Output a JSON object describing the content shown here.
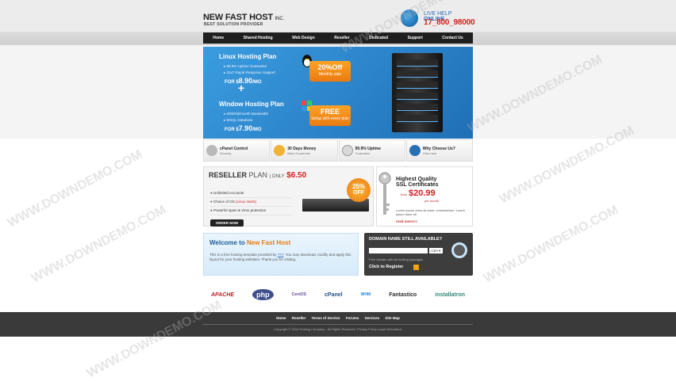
{
  "header": {
    "logo_main": "NEW FAST HOST",
    "logo_suffix": "INC.",
    "tagline": "BEST SOLUTION PROVIDER",
    "live_help_a": "LIVE HELP",
    "live_help_b": "ONLINE",
    "phone": "17_800_98000"
  },
  "nav": [
    "Home",
    "Shared Hosting",
    "Web Design",
    "Reseller",
    "Dedicated",
    "Support",
    "Contact Us"
  ],
  "hero": {
    "linux": {
      "title": "Linux Hosting Plan",
      "features": [
        "99.9% Uptime Guarantee",
        "24x7 Rapid Response Support"
      ],
      "price_prefix": "FOR $",
      "price": "8.90",
      "price_suffix": "/MO",
      "badge_big": "20%Off",
      "badge_small": "Monthly sale"
    },
    "window": {
      "title": "Window Hosting Plan",
      "features": [
        "2000GB/month Bandwidth",
        "MSQL Database"
      ],
      "price_prefix": "FOR $",
      "price": "7.90",
      "price_suffix": "/MO",
      "badge_big": "FREE",
      "badge_small": "Setup with every plan"
    }
  },
  "features": [
    {
      "title": "cPanel Control",
      "sub": "Security",
      "icon": "gear-icon",
      "color": "#b9b9b9"
    },
    {
      "title": "30 Days Money",
      "sub": "Back Guarantee",
      "icon": "coins-icon",
      "color": "#f2b233"
    },
    {
      "title": "99.9% Uptime",
      "sub": "Guarantee",
      "icon": "clock-icon",
      "color": "#d9d9d9"
    },
    {
      "title": "Why Choose Us?",
      "sub": "Click here",
      "icon": "question-icon",
      "color": "#2a6eb5"
    }
  ],
  "reseller": {
    "title": "RESELLER",
    "plan": "PLAN",
    "only": "| ONLY",
    "price": "$6.50",
    "items": [
      {
        "text": "Unlimited Accounts",
        "em": ""
      },
      {
        "text": "Choice of OS ",
        "em": "(Linux starts)"
      },
      {
        "text": "Powerful spam & Virus protection",
        "em": ""
      }
    ],
    "order": "ORDER NOW",
    "off_pct": "25%",
    "off_word": "OFF"
  },
  "ssl": {
    "title1": "Highest Quality",
    "title2": "SSL Certificates",
    "from": "from",
    "price": "$20.99",
    "per": "per month",
    "desc": "Lorem ipsum dolor sit amet, consectetuer .Lorem ipsum dolor sit",
    "more": "read more>>"
  },
  "welcome": {
    "title_a": "Welcome to",
    "title_b": "New Fast Host",
    "text_a": "This is a free hosting template provided by",
    "link": "???",
    "text_b": ". You may download, modify and apply this layout for your hosting websites. Thank you for visiting."
  },
  "domain": {
    "title": "DOMAIN NAME STILL AVAILABLE?",
    "tld": ".com",
    "note": "Free domain with all hosting packages",
    "register": "Click to Register"
  },
  "logos": [
    {
      "name": "APACHE",
      "color": "#b8232a"
    },
    {
      "name": "php",
      "color": "#3f4f8f"
    },
    {
      "name": "CentOS",
      "color": "#6b4c9a"
    },
    {
      "name": "cPanel",
      "color": "#1c4f8a"
    },
    {
      "name": "WHM",
      "color": "#1b8ad1"
    },
    {
      "name": "Fantastico",
      "color": "#2a2a2a"
    },
    {
      "name": "installatron",
      "color": "#2d8a7a"
    }
  ],
  "footer": {
    "links": [
      "Home",
      "Reseller",
      "Terms of Service",
      "Forums",
      "Services",
      "Site Map"
    ],
    "copyright": "Copyright © 2014 Hosting Company - All Rights Reserved. Privacy Policy Legal Information"
  },
  "watermark": "WWW.DOWNDEMO.COM"
}
